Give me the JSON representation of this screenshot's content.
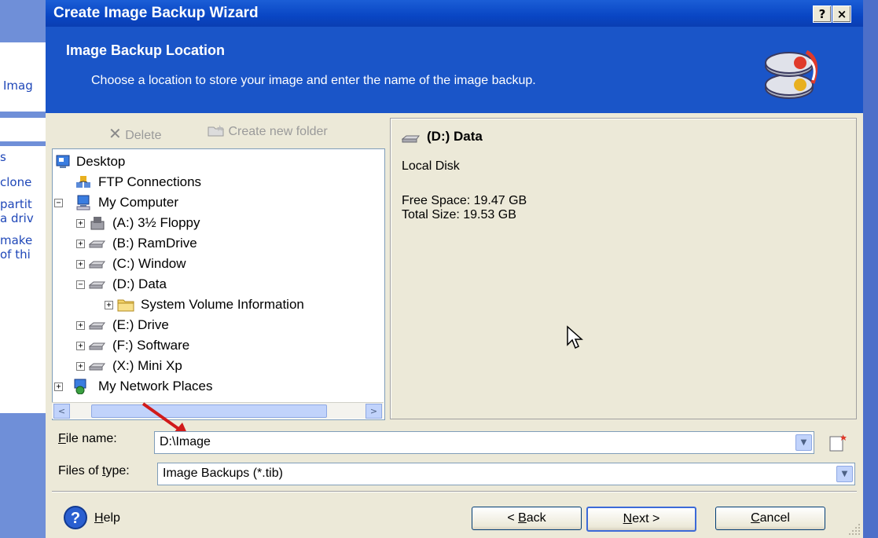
{
  "background_app": {
    "left_items": [
      "Imag",
      "s",
      "clone",
      "partit",
      "a driv",
      "make",
      "of thi"
    ]
  },
  "window": {
    "title": "Create Image Backup Wizard",
    "help_button": "?",
    "close_button": "×"
  },
  "header": {
    "title": "Image Backup Location",
    "subtitle": "Choose a location to store your image and enter the name of the image backup.",
    "logo_icon": "backup-disks-icon"
  },
  "toolbar": {
    "delete_label": "Delete",
    "new_folder_label": "Create new folder"
  },
  "tree": {
    "items": [
      {
        "label": "Desktop",
        "icon": "desktop-icon"
      },
      {
        "label": "FTP Connections",
        "icon": "ftp-icon"
      },
      {
        "label": "My Computer",
        "icon": "computer-icon",
        "toggle": "−"
      },
      {
        "label": "(A:) 3½ Floppy",
        "icon": "floppy-icon",
        "toggle": "+"
      },
      {
        "label": "(B:) RamDrive",
        "icon": "drive-icon",
        "toggle": "+"
      },
      {
        "label": "(C:) Window",
        "icon": "drive-icon",
        "toggle": "+"
      },
      {
        "label": "(D:) Data",
        "icon": "drive-icon",
        "toggle": "−"
      },
      {
        "label": "System Volume Information",
        "icon": "folder-icon",
        "toggle": "+"
      },
      {
        "label": "(E:) Drive",
        "icon": "drive-icon",
        "toggle": "+"
      },
      {
        "label": "(F:) Software",
        "icon": "drive-icon",
        "toggle": "+"
      },
      {
        "label": "(X:) Mini Xp",
        "icon": "drive-icon",
        "toggle": "+"
      },
      {
        "label": "My Network Places",
        "icon": "network-icon",
        "toggle": "+"
      }
    ],
    "scroll_left": "<",
    "scroll_right": ">"
  },
  "details": {
    "drive_title": "(D:) Data",
    "drive_type": "Local Disk",
    "free_space": "Free Space: 19.47 GB",
    "total_size": "Total Size: 19.53 GB"
  },
  "file_name": {
    "label": "File name:",
    "value": "D:\\Image"
  },
  "file_type": {
    "label": "Files of type:",
    "value": "Image Backups (*.tib)"
  },
  "buttons": {
    "help": "Help",
    "back": "< Back",
    "next": "Next >",
    "cancel": "Cancel"
  },
  "colors": {
    "title_bar": "#0a4ac6",
    "header_bg": "#1a55c8",
    "dialog_bg": "#ece9d8",
    "annotation_arrow": "#d11a1a"
  }
}
